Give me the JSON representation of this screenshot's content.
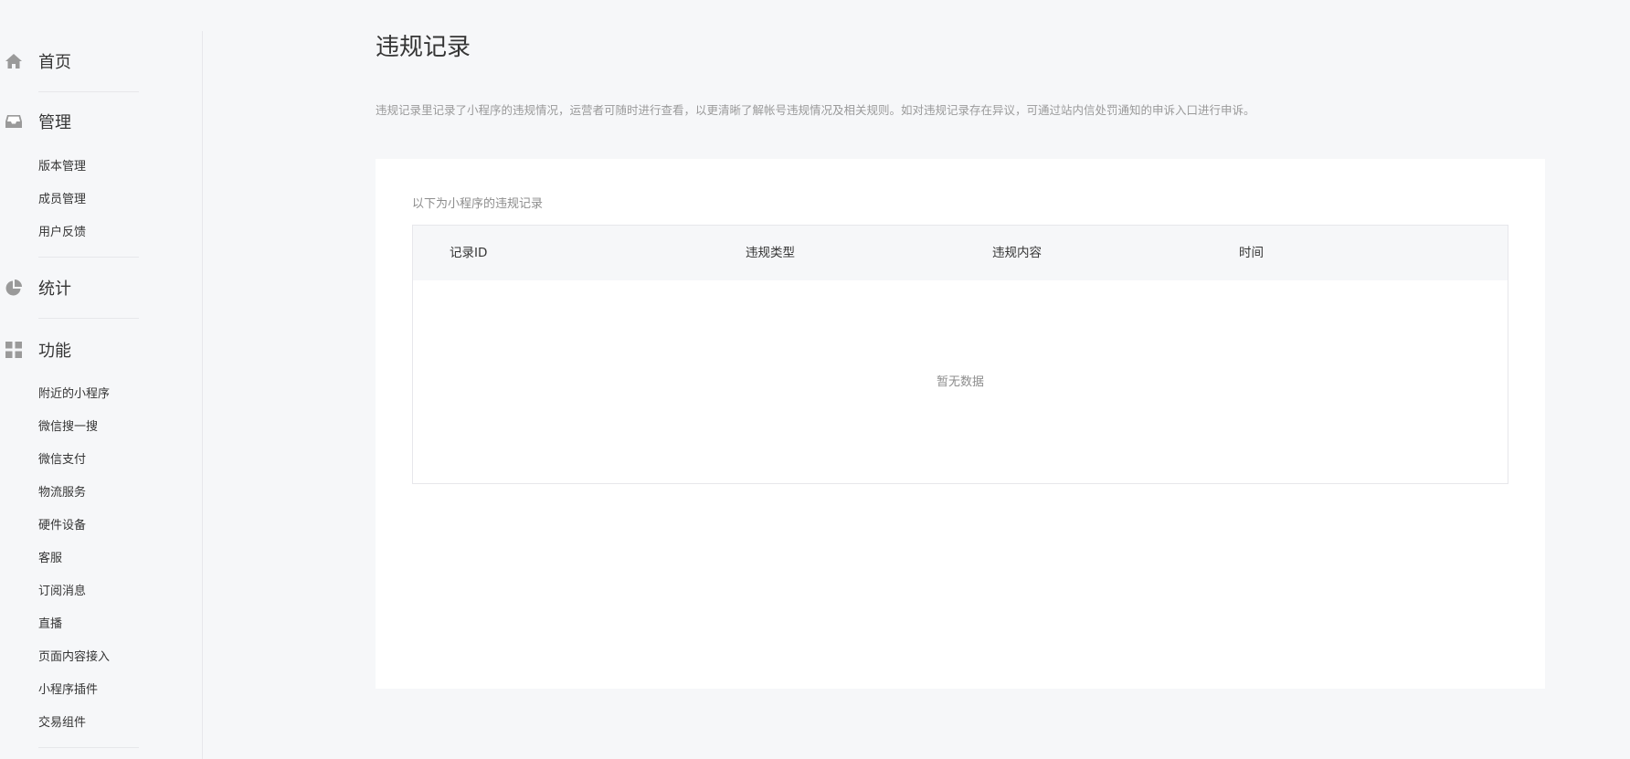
{
  "sidebar": {
    "home": {
      "label": "首页",
      "icon": "home-icon"
    },
    "manage": {
      "label": "管理",
      "icon": "inbox-icon",
      "items": [
        "版本管理",
        "成员管理",
        "用户反馈"
      ]
    },
    "stats": {
      "label": "统计",
      "icon": "pie-chart-icon"
    },
    "features": {
      "label": "功能",
      "icon": "grid-icon",
      "items": [
        "附近的小程序",
        "微信搜一搜",
        "微信支付",
        "物流服务",
        "硬件设备",
        "客服",
        "订阅消息",
        "直播",
        "页面内容接入",
        "小程序插件",
        "交易组件"
      ]
    }
  },
  "main": {
    "title": "违规记录",
    "description": "违规记录里记录了小程序的违规情况，运营者可随时进行查看，以更清晰了解帐号违规情况及相关规则。如对违规记录存在异议，可通过站内信处罚通知的申诉入口进行申诉。",
    "card": {
      "caption": "以下为小程序的违规记录",
      "table": {
        "columns": [
          "记录ID",
          "违规类型",
          "违规内容",
          "时间"
        ],
        "rows": [],
        "empty_text": "暂无数据"
      }
    }
  },
  "colors": {
    "background": "#f6f7f9",
    "text": "#353535",
    "muted_text": "#9a9a9a",
    "icon": "#9a9a9a",
    "border": "#e7e7eb"
  }
}
